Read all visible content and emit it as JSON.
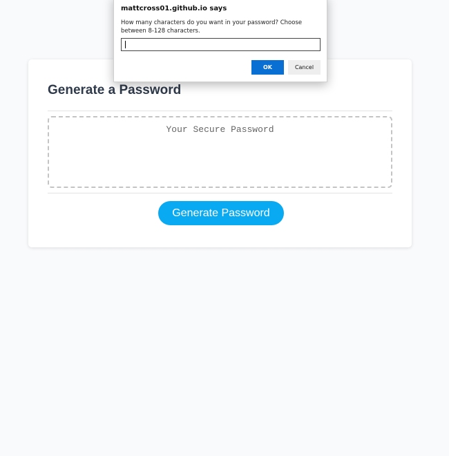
{
  "card": {
    "title": "Generate a Password",
    "password_placeholder": "Your Secure Password",
    "generate_label": "Generate Password"
  },
  "dialog": {
    "title": "mattcross01.github.io says",
    "message": "How many characters do you want in your password? Choose between 8-128 characters.",
    "input_value": "",
    "ok_label": "OK",
    "cancel_label": "Cancel"
  },
  "colors": {
    "page_background": "#f9fafc",
    "button_accent": "#0aaaf2",
    "dialog_ok": "#0a6fd3",
    "title_text": "#2f3a4a"
  }
}
